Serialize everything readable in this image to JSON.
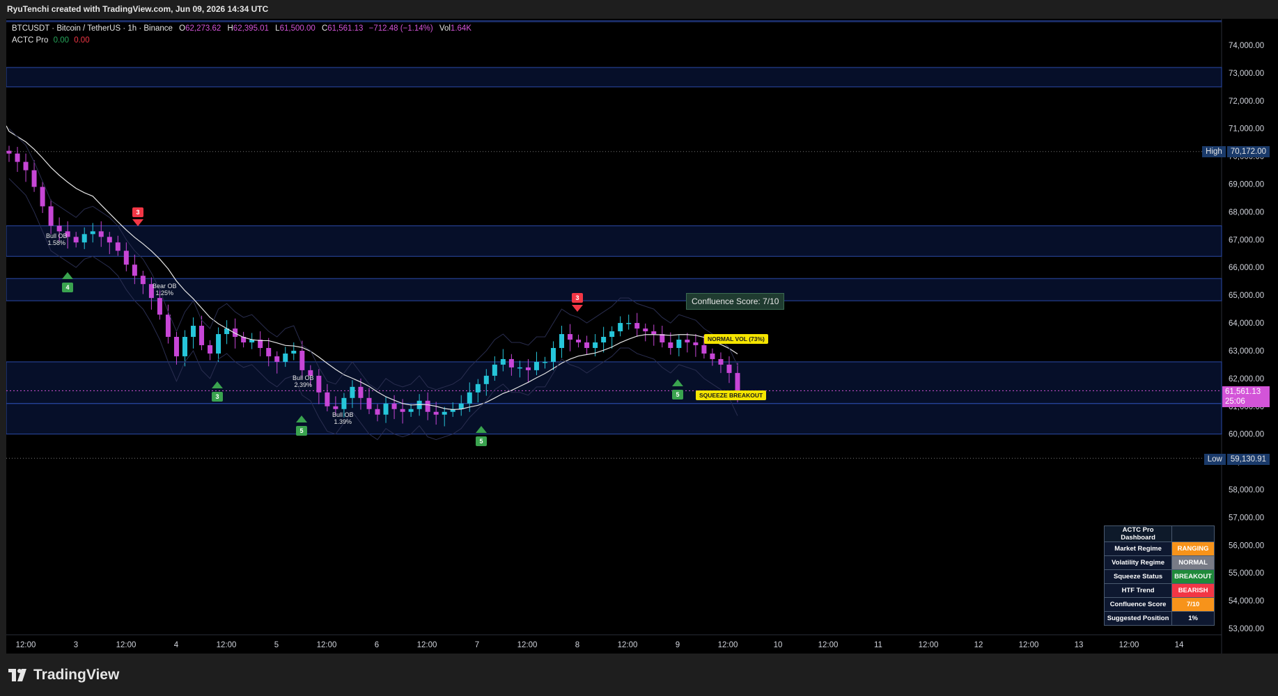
{
  "topbar": {
    "text": "RyuTenchi created with TradingView.com, Jun 09, 2026 14:34 UTC"
  },
  "header": {
    "symbol": "BTCUSDT · Bitcoin / TetherUS · 1h · Binance",
    "open_label": "O",
    "open": "62,273.62",
    "high_label": "H",
    "high": "62,395.01",
    "low_label": "L",
    "low": "61,500.00",
    "close_label": "C",
    "close": "61,561.13",
    "change": "−712.48 (−1.14%)",
    "vol_label": "Vol",
    "vol": "1.64K",
    "indicator": "ACTC Pro",
    "ind_v1": "0.00",
    "ind_v2": "0.00"
  },
  "price_axis": {
    "ticks": [
      "74,000.00",
      "73,000.00",
      "72,000.00",
      "71,000.00",
      "70,000.00",
      "69,000.00",
      "68,000.00",
      "67,000.00",
      "66,000.00",
      "65,000.00",
      "64,000.00",
      "63,000.00",
      "62,000.00",
      "61,000.00",
      "60,000.00",
      "59,000.00",
      "58,000.00",
      "57,000.00",
      "56,000.00",
      "55,000.00",
      "54,000.00",
      "53,000.00"
    ],
    "high_label": "High",
    "high_value": "70,172.00",
    "low_label": "Low",
    "low_value": "59,130.91",
    "current_price": "61,561.13",
    "countdown": "25:06"
  },
  "time_axis": {
    "labels": [
      "12:00",
      "3",
      "12:00",
      "4",
      "12:00",
      "5",
      "12:00",
      "6",
      "12:00",
      "7",
      "12:00",
      "8",
      "12:00",
      "9",
      "12:00",
      "10",
      "12:00",
      "11",
      "12:00",
      "12",
      "12:00",
      "13",
      "12:00",
      "14"
    ]
  },
  "signals": [
    {
      "dir": "up",
      "n": "4"
    },
    {
      "dir": "down",
      "n": "3"
    },
    {
      "dir": "up",
      "n": "3"
    },
    {
      "dir": "up",
      "n": "5"
    },
    {
      "dir": "up",
      "n": "5"
    },
    {
      "dir": "down",
      "n": "3"
    },
    {
      "dir": "up",
      "n": "5"
    }
  ],
  "ob_labels": [
    {
      "t1": "Bull OB",
      "t2": "1.58%"
    },
    {
      "t1": "Bear OB",
      "t2": "1.25%"
    },
    {
      "t1": "Bull OB",
      "t2": "2.39%"
    },
    {
      "t1": "Bull OB",
      "t2": "1.39%"
    }
  ],
  "callouts": {
    "confluence": "Confluence Score: 7/10",
    "normal_vol": "NORMAL VOL (73%)",
    "squeeze": "SQUEEZE BREAKOUT"
  },
  "dashboard": {
    "title": "ACTC Pro Dashboard",
    "rows": [
      {
        "label": "Market Regime",
        "value": "RANGING",
        "color": "#f7931a"
      },
      {
        "label": "Volatility Regime",
        "value": "NORMAL",
        "color": "#787b86"
      },
      {
        "label": "Squeeze Status",
        "value": "BREAKOUT",
        "color": "#1f8a3a"
      },
      {
        "label": "HTF Trend",
        "value": "BEARISH",
        "color": "#f23645"
      },
      {
        "label": "Confluence Score",
        "value": "7/10",
        "color": "#f7931a"
      },
      {
        "label": "Suggested Position",
        "value": "1%",
        "color": "#0e1830"
      }
    ]
  },
  "colors": {
    "bull": "#26c6da",
    "bear": "#c746d6",
    "zone": "#1a3a8a",
    "sma": "#e6e6e6",
    "up_arrow": "#3aa34f",
    "down_arrow": "#f23645"
  },
  "branding": {
    "logo_text": "TradingView"
  },
  "chart_data": {
    "type": "candlestick",
    "ylim": [
      52600,
      74600
    ],
    "close_series": [
      70100,
      69800,
      69500,
      68900,
      68200,
      67500,
      67300,
      67100,
      66900,
      67200,
      67300,
      67100,
      66900,
      66600,
      66100,
      65700,
      65400,
      64900,
      64300,
      63500,
      62800,
      63500,
      63900,
      63200,
      62900,
      63600,
      63800,
      63500,
      63300,
      63400,
      63100,
      62800,
      62600,
      62900,
      63000,
      62300,
      62100,
      61500,
      61000,
      60900,
      61300,
      61700,
      61300,
      60900,
      60700,
      61100,
      60900,
      60800,
      60900,
      61200,
      60800,
      60700,
      60800,
      60900,
      61100,
      61500,
      61800,
      62100,
      62500,
      62700,
      62400,
      62400,
      62300,
      62600,
      62600,
      63100,
      63600,
      63400,
      63300,
      63100,
      63300,
      63500,
      63700,
      64000,
      64000,
      63800,
      63700,
      63600,
      63300,
      63100,
      63400,
      63300,
      63200,
      62900,
      62700,
      62500,
      62200,
      61560
    ],
    "resistance_zones": [
      [
        72500,
        73200
      ],
      [
        66400,
        67500
      ],
      [
        64800,
        65600
      ],
      [
        61100,
        62600
      ],
      [
        60000,
        61100
      ]
    ]
  }
}
